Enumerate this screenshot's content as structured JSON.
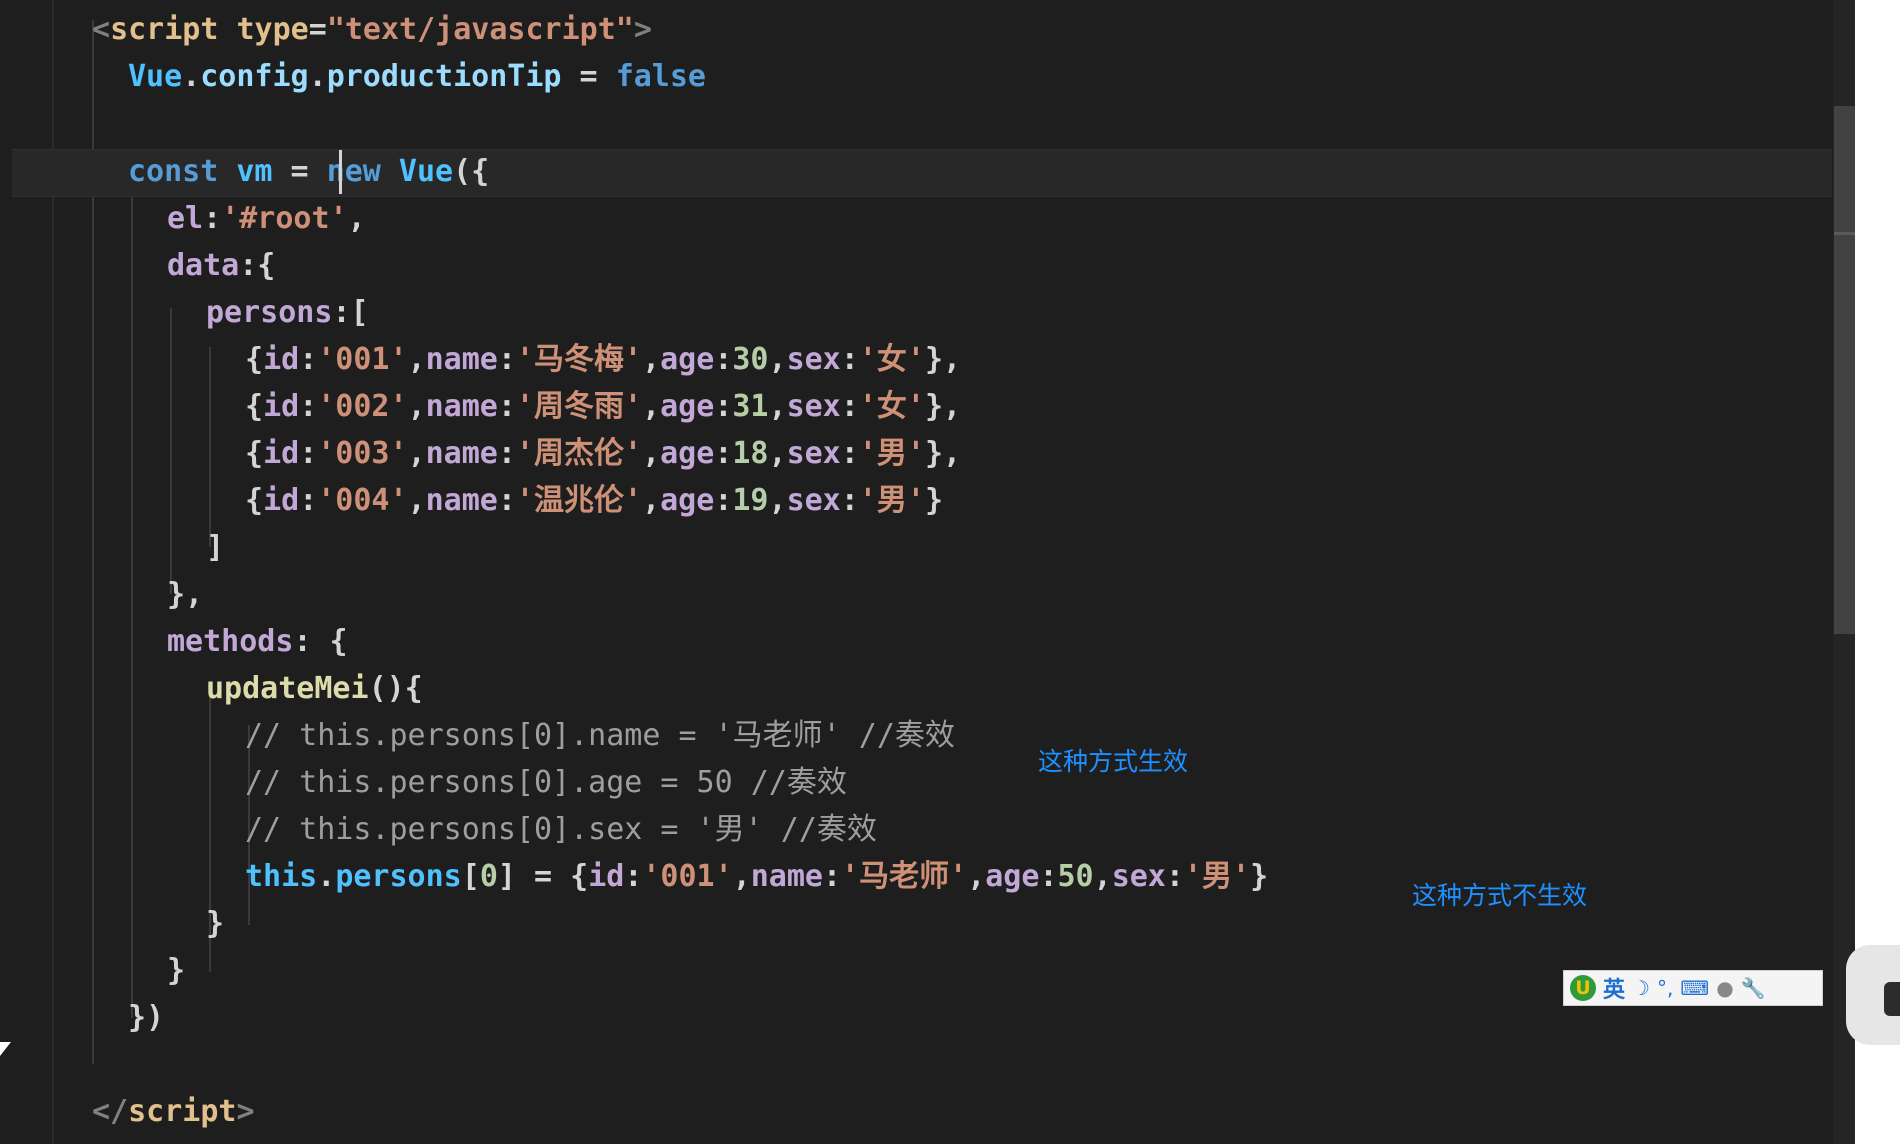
{
  "colors": {
    "background": "#1e1e1e",
    "annotation": "#1e90ff",
    "tag": "#808080",
    "tag_name": "#e2c08d",
    "attr": "#e2c08d",
    "string": "#ce9178",
    "variable": "#4fc1ff",
    "property": "#9cdcfe",
    "keyword": "#569cd6",
    "key": "#c3a8d7",
    "number": "#b5cea8",
    "comment": "#9e9e9e",
    "function": "#dcdcaa",
    "punct": "#d4d4d4"
  },
  "code_lines": [
    [
      {
        "t": "<",
        "c": "tag"
      },
      {
        "t": "script",
        "c": "tag_name"
      },
      {
        "t": " type",
        "c": "attr"
      },
      {
        "t": "=",
        "c": "punct"
      },
      {
        "t": "\"text/javascript\"",
        "c": "string"
      },
      {
        "t": ">",
        "c": "tag"
      }
    ],
    [
      {
        "t": "Vue",
        "c": "variable"
      },
      {
        "t": ".",
        "c": "punct"
      },
      {
        "t": "config",
        "c": "property"
      },
      {
        "t": ".",
        "c": "punct"
      },
      {
        "t": "productionTip",
        "c": "property"
      },
      {
        "t": " = ",
        "c": "punct"
      },
      {
        "t": "false",
        "c": "keyword"
      }
    ],
    [],
    [
      {
        "t": "const",
        "c": "keyword"
      },
      {
        "t": " vm",
        "c": "variable"
      },
      {
        "t": " = ",
        "c": "punct"
      },
      {
        "t": "new",
        "c": "keyword"
      },
      {
        "t": " Vue",
        "c": "variable"
      },
      {
        "t": "({",
        "c": "punct"
      }
    ],
    [
      {
        "t": "el",
        "c": "key"
      },
      {
        "t": ":",
        "c": "punct"
      },
      {
        "t": "'#root'",
        "c": "string"
      },
      {
        "t": ",",
        "c": "punct"
      }
    ],
    [
      {
        "t": "data",
        "c": "key"
      },
      {
        "t": ":{",
        "c": "punct"
      }
    ],
    [
      {
        "t": "persons",
        "c": "key"
      },
      {
        "t": ":[",
        "c": "punct"
      }
    ],
    [
      {
        "t": "{",
        "c": "punct"
      },
      {
        "t": "id",
        "c": "key"
      },
      {
        "t": ":",
        "c": "punct"
      },
      {
        "t": "'001'",
        "c": "string"
      },
      {
        "t": ",",
        "c": "punct"
      },
      {
        "t": "name",
        "c": "key"
      },
      {
        "t": ":",
        "c": "punct"
      },
      {
        "t": "'马冬梅'",
        "c": "string"
      },
      {
        "t": ",",
        "c": "punct"
      },
      {
        "t": "age",
        "c": "key"
      },
      {
        "t": ":",
        "c": "punct"
      },
      {
        "t": "30",
        "c": "number"
      },
      {
        "t": ",",
        "c": "punct"
      },
      {
        "t": "sex",
        "c": "key"
      },
      {
        "t": ":",
        "c": "punct"
      },
      {
        "t": "'女'",
        "c": "string"
      },
      {
        "t": "},",
        "c": "punct"
      }
    ],
    [
      {
        "t": "{",
        "c": "punct"
      },
      {
        "t": "id",
        "c": "key"
      },
      {
        "t": ":",
        "c": "punct"
      },
      {
        "t": "'002'",
        "c": "string"
      },
      {
        "t": ",",
        "c": "punct"
      },
      {
        "t": "name",
        "c": "key"
      },
      {
        "t": ":",
        "c": "punct"
      },
      {
        "t": "'周冬雨'",
        "c": "string"
      },
      {
        "t": ",",
        "c": "punct"
      },
      {
        "t": "age",
        "c": "key"
      },
      {
        "t": ":",
        "c": "punct"
      },
      {
        "t": "31",
        "c": "number"
      },
      {
        "t": ",",
        "c": "punct"
      },
      {
        "t": "sex",
        "c": "key"
      },
      {
        "t": ":",
        "c": "punct"
      },
      {
        "t": "'女'",
        "c": "string"
      },
      {
        "t": "},",
        "c": "punct"
      }
    ],
    [
      {
        "t": "{",
        "c": "punct"
      },
      {
        "t": "id",
        "c": "key"
      },
      {
        "t": ":",
        "c": "punct"
      },
      {
        "t": "'003'",
        "c": "string"
      },
      {
        "t": ",",
        "c": "punct"
      },
      {
        "t": "name",
        "c": "key"
      },
      {
        "t": ":",
        "c": "punct"
      },
      {
        "t": "'周杰伦'",
        "c": "string"
      },
      {
        "t": ",",
        "c": "punct"
      },
      {
        "t": "age",
        "c": "key"
      },
      {
        "t": ":",
        "c": "punct"
      },
      {
        "t": "18",
        "c": "number"
      },
      {
        "t": ",",
        "c": "punct"
      },
      {
        "t": "sex",
        "c": "key"
      },
      {
        "t": ":",
        "c": "punct"
      },
      {
        "t": "'男'",
        "c": "string"
      },
      {
        "t": "},",
        "c": "punct"
      }
    ],
    [
      {
        "t": "{",
        "c": "punct"
      },
      {
        "t": "id",
        "c": "key"
      },
      {
        "t": ":",
        "c": "punct"
      },
      {
        "t": "'004'",
        "c": "string"
      },
      {
        "t": ",",
        "c": "punct"
      },
      {
        "t": "name",
        "c": "key"
      },
      {
        "t": ":",
        "c": "punct"
      },
      {
        "t": "'温兆伦'",
        "c": "string"
      },
      {
        "t": ",",
        "c": "punct"
      },
      {
        "t": "age",
        "c": "key"
      },
      {
        "t": ":",
        "c": "punct"
      },
      {
        "t": "19",
        "c": "number"
      },
      {
        "t": ",",
        "c": "punct"
      },
      {
        "t": "sex",
        "c": "key"
      },
      {
        "t": ":",
        "c": "punct"
      },
      {
        "t": "'男'",
        "c": "string"
      },
      {
        "t": "}",
        "c": "punct"
      }
    ],
    [
      {
        "t": "]",
        "c": "punct"
      }
    ],
    [
      {
        "t": "},",
        "c": "punct"
      }
    ],
    [
      {
        "t": "methods",
        "c": "key"
      },
      {
        "t": ": {",
        "c": "punct"
      }
    ],
    [
      {
        "t": "updateMei",
        "c": "function"
      },
      {
        "t": "(){",
        "c": "punct"
      }
    ],
    [
      {
        "t": "// this.persons[0].name = '马老师' //奏效",
        "c": "comment"
      }
    ],
    [
      {
        "t": "// this.persons[0].age = 50 //奏效",
        "c": "comment"
      }
    ],
    [
      {
        "t": "// this.persons[0].sex = '男' //奏效",
        "c": "comment"
      }
    ],
    [
      {
        "t": "this",
        "c": "variable"
      },
      {
        "t": ".",
        "c": "punct"
      },
      {
        "t": "persons",
        "c": "variable"
      },
      {
        "t": "[",
        "c": "punct"
      },
      {
        "t": "0",
        "c": "number"
      },
      {
        "t": "] = {",
        "c": "punct"
      },
      {
        "t": "id",
        "c": "key"
      },
      {
        "t": ":",
        "c": "punct"
      },
      {
        "t": "'001'",
        "c": "string"
      },
      {
        "t": ",",
        "c": "punct"
      },
      {
        "t": "name",
        "c": "key"
      },
      {
        "t": ":",
        "c": "punct"
      },
      {
        "t": "'马老师'",
        "c": "string"
      },
      {
        "t": ",",
        "c": "punct"
      },
      {
        "t": "age",
        "c": "key"
      },
      {
        "t": ":",
        "c": "punct"
      },
      {
        "t": "50",
        "c": "number"
      },
      {
        "t": ",",
        "c": "punct"
      },
      {
        "t": "sex",
        "c": "key"
      },
      {
        "t": ":",
        "c": "punct"
      },
      {
        "t": "'男'",
        "c": "string"
      },
      {
        "t": "}",
        "c": "punct"
      }
    ],
    [
      {
        "t": "}",
        "c": "punct"
      }
    ],
    [
      {
        "t": "}",
        "c": "punct"
      }
    ],
    [
      {
        "t": "})",
        "c": "punct"
      }
    ],
    [],
    [
      {
        "t": "</",
        "c": "tag"
      },
      {
        "t": "script",
        "c": "tag_name"
      },
      {
        "t": ">",
        "c": "tag"
      }
    ]
  ],
  "annotations": {
    "works": "这种方式生效",
    "not_works": "这种方式不生效"
  },
  "ime_toolbar": {
    "logo": "U",
    "mode": "英",
    "moon_icon": "☽",
    "punct_icon": "°,",
    "keyboard_icon": "⌨",
    "user_icon": "●",
    "tool_icon": "🔧"
  }
}
